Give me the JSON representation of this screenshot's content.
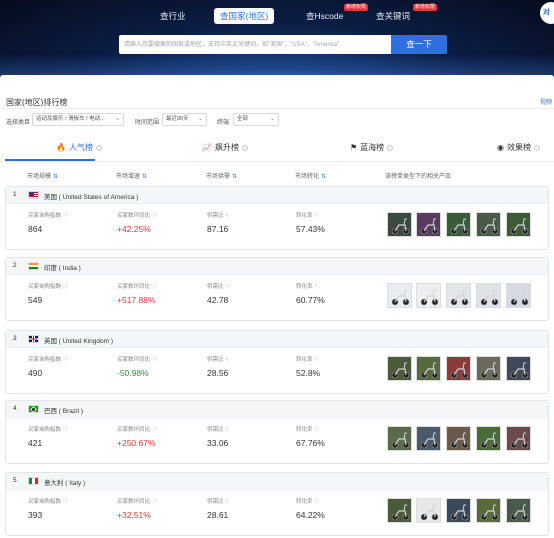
{
  "banner": {
    "tabs": [
      {
        "label": "查行业",
        "active": false
      },
      {
        "label": "查国家(地区)",
        "active": true
      },
      {
        "label": "查Hscode",
        "active": false,
        "badge": "新增权限"
      },
      {
        "label": "查关键词",
        "active": false,
        "badge": "新增权限"
      }
    ],
    "corner_text": "对",
    "search": {
      "placeholder": "请输入您要搜索的国家或地区，支持中英文关键词，如\"美国\"，\"USA\"，\"America\"",
      "button_label": "查一下"
    }
  },
  "section": {
    "title": "国家(地区)排行榜",
    "right_link": "视频"
  },
  "filters": [
    {
      "label": "选择类目",
      "value": "运动及娱乐 / 滑板车 / 电动..."
    },
    {
      "label": "时间范围",
      "value": "最近30天"
    },
    {
      "label": "终端",
      "value": "全部"
    }
  ],
  "rank_tabs": [
    {
      "label": "人气榜",
      "icon": "flame-icon",
      "active": true
    },
    {
      "label": "飙升榜",
      "icon": "trend-chart-icon",
      "active": false
    },
    {
      "label": "蓝海榜",
      "icon": "signpost-icon",
      "active": false
    },
    {
      "label": "效果榜",
      "icon": "eye-icon",
      "active": false
    }
  ],
  "columns": [
    {
      "label": "市场规模",
      "sortable": true
    },
    {
      "label": "市场增速",
      "sortable": true
    },
    {
      "label": "市场供需",
      "sortable": true
    },
    {
      "label": "市场转化",
      "sortable": true
    },
    {
      "label": "该榜单类型下的相关产品",
      "sortable": false
    }
  ],
  "metric_labels": [
    "买家询购指数",
    "买家数环同比",
    "供需比",
    "转化率"
  ],
  "countries": [
    {
      "rank": "1",
      "name": "美国 ( United States of America )",
      "flag": "us",
      "values": [
        "864",
        "+42.25%",
        "87.16",
        "57.43%"
      ],
      "growth_trend": "up",
      "thumb_colors": [
        "#3a4a3e",
        "#5a3a5e",
        "#3b5a3a",
        "#4a5a4a",
        "#3e5a3a"
      ]
    },
    {
      "rank": "2",
      "name": "印度 ( India )",
      "flag": "in",
      "values": [
        "549",
        "+517.88%",
        "42.78",
        "60.77%"
      ],
      "growth_trend": "up",
      "thumb_colors": [
        "#e9ecf0",
        "#eceef2",
        "#e3e6ea",
        "#dfe3e8",
        "#d6dbe1"
      ]
    },
    {
      "rank": "3",
      "name": "英国 ( United Kingdom )",
      "flag": "uk",
      "values": [
        "490",
        "-50.98%",
        "28.56",
        "52.8%"
      ],
      "growth_trend": "down",
      "thumb_colors": [
        "#4a5a3a",
        "#556a3d",
        "#8a3a3a",
        "#6a6a5a",
        "#3e4a5a"
      ]
    },
    {
      "rank": "4",
      "name": "巴西 ( Brazil )",
      "flag": "br",
      "values": [
        "421",
        "+250.67%",
        "33.06",
        "67.76%"
      ],
      "growth_trend": "up",
      "thumb_colors": [
        "#5a6a4a",
        "#4a5a6a",
        "#6a5a4a",
        "#4a6a3a",
        "#6a4a4a"
      ]
    },
    {
      "rank": "5",
      "name": "意大利 ( Italy )",
      "flag": "it",
      "values": [
        "393",
        "+32.51%",
        "28.61",
        "64.22%"
      ],
      "growth_trend": "up",
      "thumb_colors": [
        "#4a5a3a",
        "#e6e8ea",
        "#3a4a5a",
        "#5a6a3a",
        "#4a5a4a"
      ]
    }
  ],
  "colors": {
    "accent": "#2f6fe0",
    "up": "#e8333a",
    "down": "#2f8a3a"
  }
}
